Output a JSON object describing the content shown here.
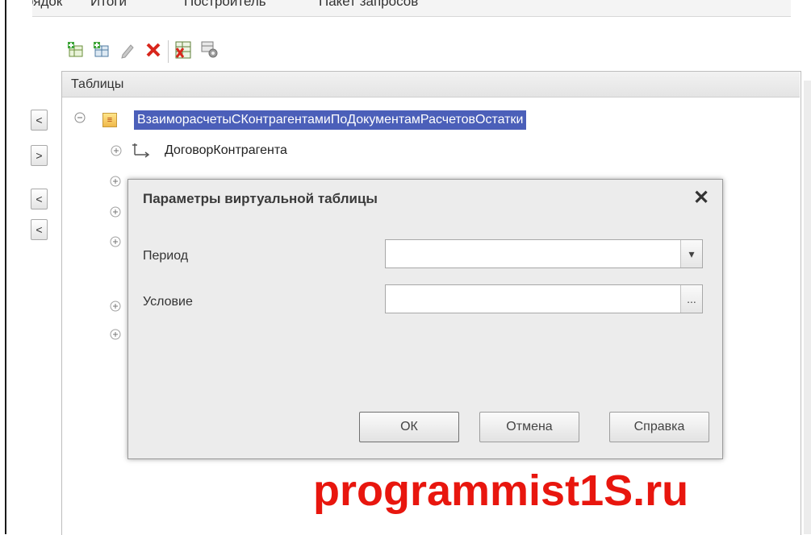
{
  "tabs": [
    "рядок",
    "Итоги",
    "Построитель",
    "Пакет запросов"
  ],
  "toolbar": {
    "icons": [
      "add-table-icon",
      "add-nested-table-icon",
      "edit-pencil-icon",
      "delete-x-icon",
      "replace-table-icon",
      "virtual-table-settings-icon"
    ]
  },
  "panel": {
    "title": "Таблицы"
  },
  "side_buttons": [
    "<",
    ">",
    "<",
    "<"
  ],
  "tree": {
    "root": "ВзаиморасчетыСКонтрагентамиПоДокументамРасчетовОстатки",
    "fields": [
      "ДоговорКонтрагента"
    ]
  },
  "dialog": {
    "title": "Параметры виртуальной таблицы",
    "close_glyph": "✕",
    "period_label": "Период",
    "period_value": "",
    "condition_label": "Условие",
    "condition_value": "",
    "dropdown_glyph": "▾",
    "ellipsis_glyph": "...",
    "ok_label": "ОК",
    "cancel_label": "Отмена",
    "help_label": "Справка"
  },
  "watermark": "programmist1S.ru",
  "colors": {
    "selection": "#4b5fb9",
    "watermark": "#e8160e"
  }
}
